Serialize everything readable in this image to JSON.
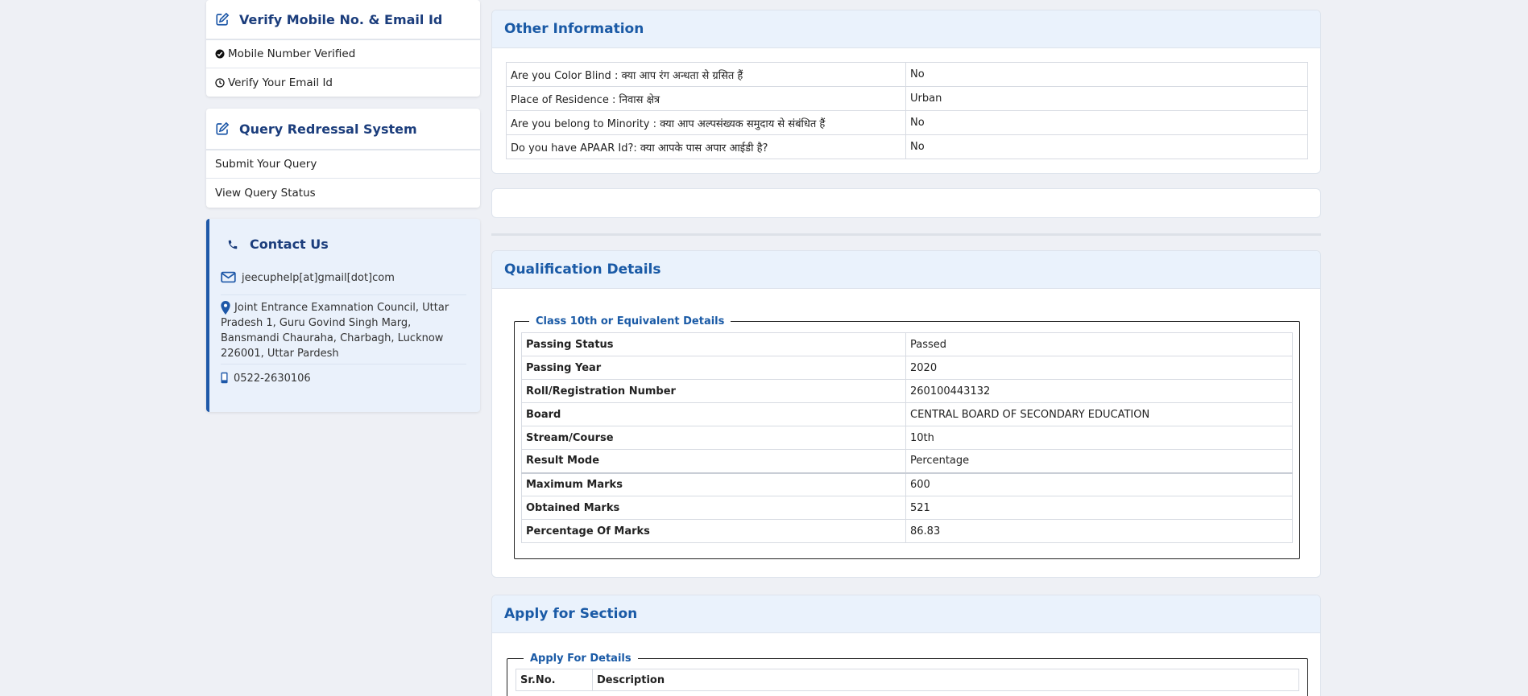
{
  "verify": {
    "title": "Verify Mobile No. & Email Id",
    "items": [
      {
        "label": "Mobile Number Verified",
        "icon": "check-circle-icon"
      },
      {
        "label": "Verify Your Email Id",
        "icon": "clock-icon"
      }
    ]
  },
  "query": {
    "title": "Query Redressal System",
    "items": [
      {
        "label": "Submit Your Query"
      },
      {
        "label": "View Query Status"
      }
    ]
  },
  "contact": {
    "title": "Contact Us",
    "email": "jeecuphelp[at]gmail[dot]com",
    "address": "Joint Entrance Examnation Council, Uttar Pradesh 1, Guru Govind Singh Marg, Bansmandi Chauraha, Charbagh, Lucknow 226001, Uttar Pardesh",
    "phone": "0522-2630106"
  },
  "other_info": {
    "title": "Other Information",
    "rows": [
      {
        "label": "Are you Color Blind : क्या आप रंग अन्धता से ग्रसित हैं",
        "value": "No"
      },
      {
        "label": "Place of Residence : निवास क्षेत्र",
        "value": "Urban"
      },
      {
        "label": "Are you belong to Minority : क्या आप अल्पसंख्यक समुदाय से संबंधित हैं",
        "value": "No"
      },
      {
        "label": "Do you have APAAR Id?: क्या आपके पास अपार आईडी है?",
        "value": "No"
      }
    ]
  },
  "qualification": {
    "title": "Qualification Details",
    "legend": "Class 10th or Equivalent Details",
    "rows": [
      {
        "label": "Passing Status",
        "value": "Passed"
      },
      {
        "label": "Passing Year",
        "value": "2020"
      },
      {
        "label": "Roll/Registration Number",
        "value": "260100443132"
      },
      {
        "label": "Board",
        "value": "CENTRAL BOARD OF SECONDARY EDUCATION"
      },
      {
        "label": "Stream/Course",
        "value": "10th"
      },
      {
        "label": "Result Mode",
        "value": "Percentage"
      },
      {
        "label": "Maximum Marks",
        "value": "600"
      },
      {
        "label": "Obtained Marks",
        "value": "521"
      },
      {
        "label": "Percentage Of Marks",
        "value": "86.83"
      }
    ]
  },
  "apply": {
    "title": "Apply for Section",
    "legend": "Apply For Details",
    "headers": [
      "Sr.No.",
      "Description"
    ]
  },
  "colors": {
    "accent": "#1a5aa6",
    "heading_dark": "#1b3d7c",
    "panel_head_bg": "#eaf2fc",
    "page_bg": "#eef0f5"
  }
}
